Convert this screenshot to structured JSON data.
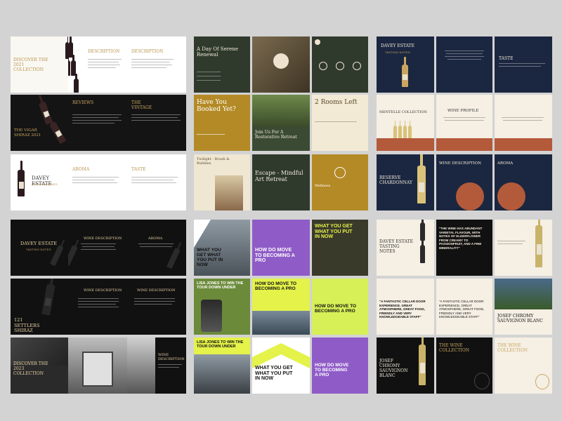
{
  "col1": {
    "discover_title": "DISCOVER THE 2021 COLLECTION",
    "description": "DESCRIPTION",
    "description2": "DESCRIPTION",
    "vigar_title": "THE VIGAR SHIRAZ 2021",
    "reviews": "REVIEWS",
    "the_vintage": "THE VINTAGE",
    "davey_estate": "DAVEY ESTATE",
    "davey_sub": "PREMIUM WINES",
    "aroma": "AROMA",
    "taste": "TASTE",
    "dark_davey": "DAVEY ESTATE",
    "dark_davey_sub": "TASTING NOTES",
    "wine_description": "WINE DESCRIPTION",
    "aroma2": "AROMA",
    "settlers": "121 SETTLERS SHIRAZ",
    "wine_description2": "WINE DESCRIPTION",
    "wine_description3": "WINE DESCRIPTION",
    "discover_2023": "DISCOVER THE 2023 COLLECTION",
    "wine_description4": "WINE DESCRIPTION"
  },
  "col2": {
    "day_of_renewal": "A Day Of Serene Renewal",
    "booked": "Have You Booked Yet?",
    "join": "Join Us For A Restorative Retreat",
    "rooms_left": "2 Rooms Left",
    "twilight": "Twilight - Brush & Bubbles",
    "escape": "Escape - Mindful Art Retreat",
    "wellness": "Wellness",
    "get_what": "WHAT YOU GET WHAT YOU PUT IN NOW",
    "how_do": "HOW DO MOVE TO BECOMING A PRO",
    "get_what2": "WHAT YOU GET WHAT YOU PUT IN NOW",
    "lisa": "LISA JONES TO WIN THE TOUR DOWN UNDER",
    "how_do2": "HOW DO MOVE TO BECOMING A PRO",
    "how_do3": "HOW DO MOVE TO BECOMING A PRO",
    "lisa2": "LISA JONES TO WIN THE TOUR DOWN UNDER",
    "get_what3": "WHAT YOU GET WHAT YOU PUT IN NOW",
    "how_do4": "HOW DO MOVE TO BECOMING A PRO"
  },
  "col3": {
    "davey_estate": "DAVEY ESTATE",
    "davey_sub": "TASTING NOTES",
    "taste": "TASTE",
    "mentelle": "MENTELLE COLLECTION",
    "wine_profile": "WINE PROFILE",
    "reserve": "RESERVE CHARDONNAY",
    "wine_description": "WINE DESCRIPTION",
    "aroma": "AROMA",
    "davey_tasting": "DAVEY ESTATE TASTING NOTES",
    "quote1": "\"THE WINE HAS ABUNDANT VARIETAL FLAVOUR, WITH NOTES OF ELDERFLOWER FROM CREAMY TO PASSIONFRUIT, AND A FINE MINERALITY\"",
    "josef1": "JOSEF CHROMY SAUVIGNON BLANC",
    "quote2": "\"A FANTASTIC CELLAR DOOR EXPERIENCE. GREAT ATMOSPHERE, GREAT FOOD, FRIENDLY AND VERY KNOWLEDGEABLE STAFF\"",
    "quote3": "\"A FANTASTIC CELLAR DOOR EXPERIENCE, GREAT ATMOSPHERE, GREAT FOOD, FRIENDLY AND VERY KNOWLEDGEABLE STAFF\"",
    "josef2": "JOSEF CHROMY SAUVIGNON BLANC",
    "wine_collection": "THE WINE COLLECTION",
    "wine_collection2": "THE WINE COLLECTION"
  }
}
